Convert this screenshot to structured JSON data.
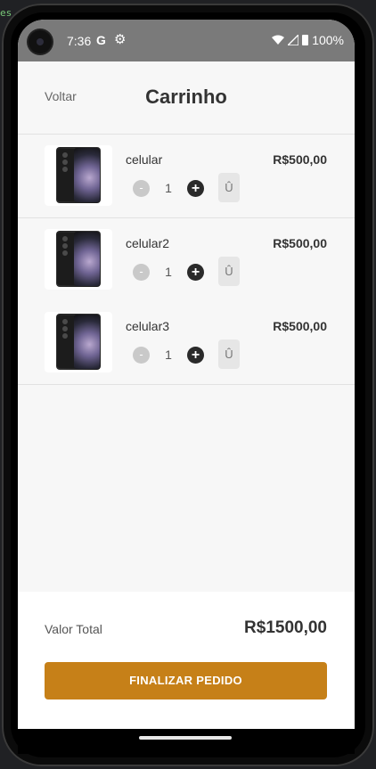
{
  "ide_fragment": "es",
  "status_bar": {
    "time": "7:36",
    "google_glyph": "G",
    "settings_glyph": "⚙",
    "battery": "100%",
    "icons": [
      "wifi-icon",
      "signal-icon",
      "battery-icon"
    ]
  },
  "header": {
    "back_label": "Voltar",
    "title": "Carrinho"
  },
  "cart": {
    "items": [
      {
        "name": "celular",
        "price": "R$500,00",
        "quantity": "1",
        "minus_label": "-",
        "plus_label": "+",
        "delete_label": "Û"
      },
      {
        "name": "celular2",
        "price": "R$500,00",
        "quantity": "1",
        "minus_label": "-",
        "plus_label": "+",
        "delete_label": "Û"
      },
      {
        "name": "celular3",
        "price": "R$500,00",
        "quantity": "1",
        "minus_label": "-",
        "plus_label": "+",
        "delete_label": "Û"
      }
    ]
  },
  "footer": {
    "total_label": "Valor Total",
    "total_value": "R$1500,00",
    "checkout_label": "FINALIZAR PEDIDO"
  },
  "colors": {
    "accent": "#c68018",
    "status_bar": "#7a7a7a",
    "background": "#f7f7f7"
  }
}
